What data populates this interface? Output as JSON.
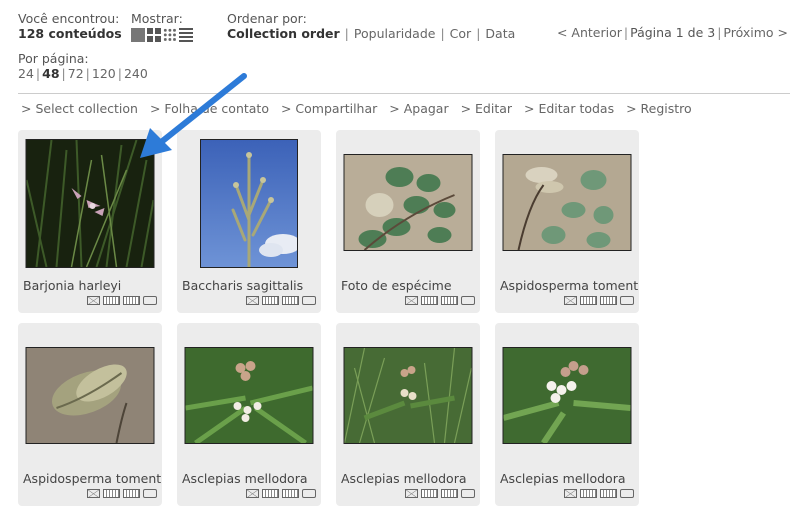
{
  "summary": {
    "label": "Você encontrou:",
    "count": "128 conteúdos"
  },
  "display": {
    "label": "Mostrar:",
    "modes": [
      "small-thumbnails",
      "large-thumbnails",
      "extra-small-thumbnails",
      "list"
    ]
  },
  "sort": {
    "label": "Ordenar por:",
    "options": [
      "Collection order",
      "Popularidade",
      "Cor",
      "Data"
    ],
    "selected": "Collection order"
  },
  "pagination": {
    "prev": "< Anterior",
    "page_info": "Página 1 de 3",
    "next": "Próximo >"
  },
  "per_page": {
    "label": "Por página:",
    "options": [
      "24",
      "48",
      "72",
      "120",
      "240"
    ],
    "selected": "48"
  },
  "actions": [
    "> Select collection",
    "> Folha de contato",
    "> Compartilhar",
    "> Apagar",
    "> Editar",
    "> Editar todas",
    "> Registro"
  ],
  "colors": {
    "card_bg": "#ececec",
    "arrow": "#2d7bd8"
  },
  "items": [
    {
      "title": "Barjonia harleyi",
      "image": "orchid-dark-grass"
    },
    {
      "title": "Baccharis sagittalis",
      "image": "plant-blue-sky"
    },
    {
      "title": "Foto de espécime",
      "image": "leaves-on-sand"
    },
    {
      "title": "Aspidosperma tomentosum",
      "image": "leaves-and-pods-on-sand"
    },
    {
      "title": "Aspidosperma tomentosum",
      "image": "seed-pod-on-ground"
    },
    {
      "title": "Asclepias mellodora",
      "image": "flower-cluster"
    },
    {
      "title": "Asclepias mellodora",
      "image": "flower-buds-grass"
    },
    {
      "title": "Asclepias mellodora",
      "image": "white-flower-cluster"
    }
  ]
}
